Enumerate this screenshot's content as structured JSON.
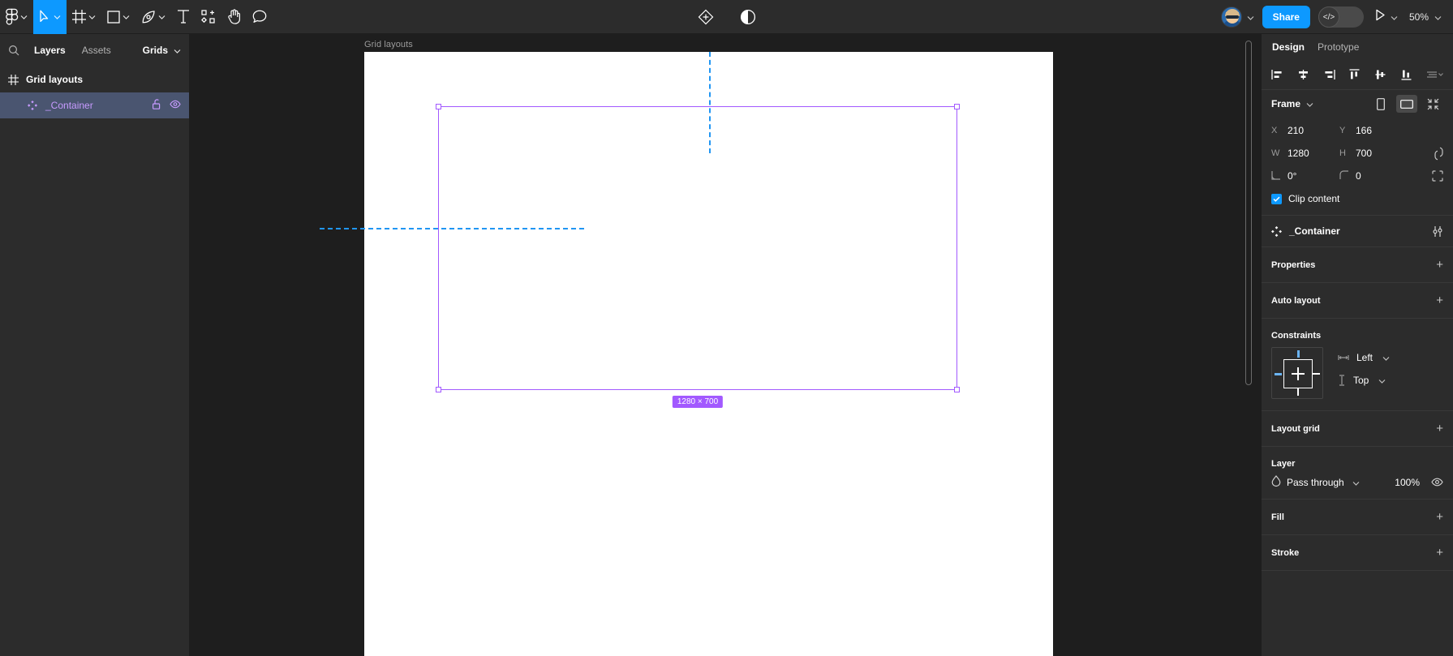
{
  "toolbar": {
    "tools": [
      {
        "name": "figma-logo-icon",
        "caret": true
      },
      {
        "name": "move-tool-icon",
        "caret": true,
        "active": true
      },
      {
        "name": "frame-tool-icon",
        "caret": true
      },
      {
        "name": "shape-tool-icon",
        "caret": true
      },
      {
        "name": "pen-tool-icon",
        "caret": true
      },
      {
        "name": "text-tool-icon",
        "caret": false
      },
      {
        "name": "components-tool-icon",
        "caret": false
      },
      {
        "name": "hand-tool-icon",
        "caret": false
      },
      {
        "name": "comment-tool-icon",
        "caret": false
      }
    ],
    "center_actions": [
      "actions-diamond-icon",
      "contrast-icon"
    ],
    "share_label": "Share",
    "code_icon": "code-brackets-icon",
    "present_icon": "play-icon",
    "zoom_level": "50%"
  },
  "left_panel": {
    "search_icon": "search-icon",
    "tabs": [
      {
        "label": "Layers",
        "active": true
      },
      {
        "label": "Assets",
        "active": false
      }
    ],
    "grids_label": "Grids",
    "layers": [
      {
        "name": "Grid layouts",
        "icon": "page-grid-icon",
        "type": "page",
        "selected": false
      },
      {
        "name": "_Container",
        "icon": "component-set-icon",
        "type": "child",
        "selected": true,
        "actions": [
          "unlock-icon",
          "eye-icon"
        ]
      }
    ]
  },
  "canvas": {
    "frame_label": "Grid layouts",
    "selection_size_badge": "1280 × 700",
    "selection_color": "#a259ff",
    "guide_color": "#2196f3",
    "frame_background": "#ffffff"
  },
  "right_panel": {
    "tabs": [
      {
        "label": "Design",
        "active": true
      },
      {
        "label": "Prototype",
        "active": false
      }
    ],
    "align_icons": [
      "align-left-icon",
      "align-horizontal-center-icon",
      "align-right-icon",
      "align-top-icon",
      "align-vertical-center-icon",
      "align-bottom-icon",
      "distribute-more-icon"
    ],
    "frame_section": {
      "title": "Frame",
      "device_buttons": [
        {
          "name": "portrait-orientation-icon",
          "active": false
        },
        {
          "name": "landscape-orientation-icon",
          "active": true
        }
      ],
      "fit_icon": "resize-to-fit-icon",
      "fields": [
        {
          "label": "X",
          "value": "210"
        },
        {
          "label": "Y",
          "value": "166"
        },
        {
          "label": "W",
          "value": "1280"
        },
        {
          "label": "H",
          "value": "700"
        },
        {
          "label": "rotation-icon",
          "value": "0°"
        },
        {
          "label": "corner-radius-icon",
          "value": "0"
        }
      ],
      "constrain_proportions_icon": "link-proportions-icon",
      "independent_corners_icon": "independent-corners-icon",
      "clip_content_label": "Clip content",
      "clip_content_checked": true
    },
    "component": {
      "name": "_Container",
      "icon": "component-set-icon",
      "actions_icon": "component-settings-icon"
    },
    "sections": [
      {
        "title": "Properties",
        "action": "+"
      },
      {
        "title": "Auto layout",
        "action": "+"
      }
    ],
    "constraints": {
      "title": "Constraints",
      "horizontal": "Left",
      "vertical": "Top",
      "horizontal_icon": "horizontal-constraint-icon",
      "vertical_icon": "vertical-constraint-icon"
    },
    "layout_grid": {
      "title": "Layout grid",
      "action": "+"
    },
    "layer": {
      "title": "Layer",
      "blend_mode": "Pass through",
      "blend_icon": "blend-mode-icon",
      "opacity": "100%",
      "visibility_icon": "eye-icon"
    },
    "fill": {
      "title": "Fill",
      "action": "+"
    },
    "stroke": {
      "title": "Stroke",
      "action": "+"
    }
  }
}
